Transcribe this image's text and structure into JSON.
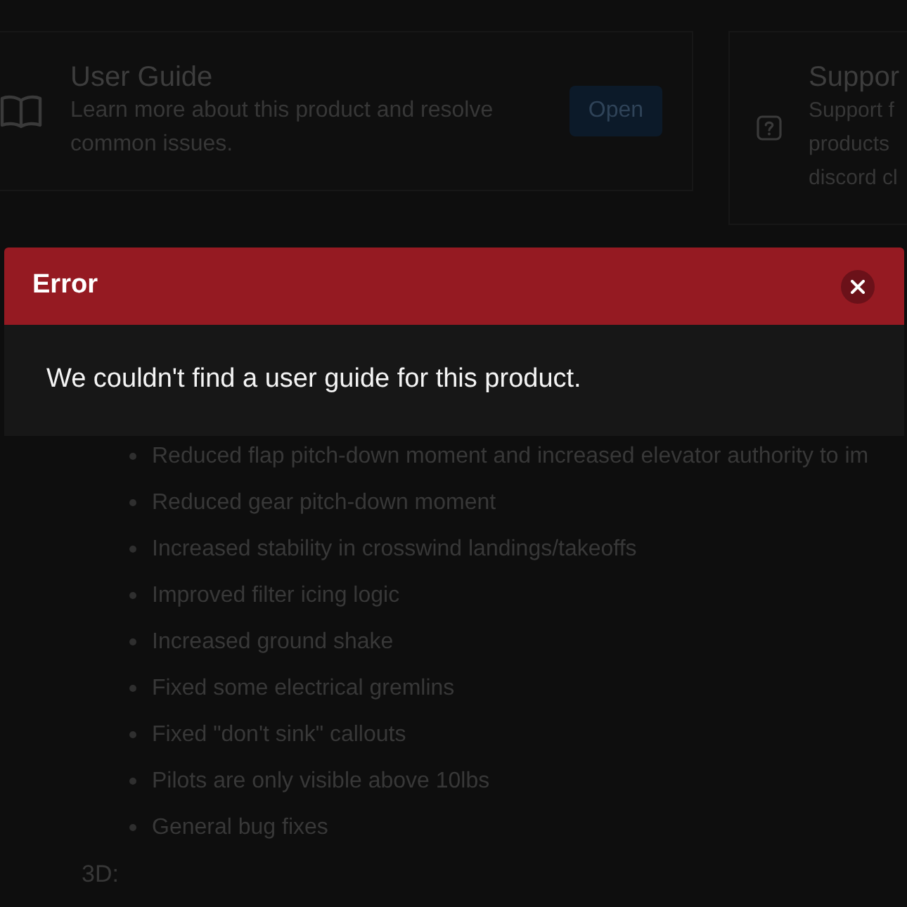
{
  "cards": [
    {
      "kind": "guide",
      "title": "User Guide",
      "description_lines": [
        "Learn more about this product and resolve common issues."
      ],
      "button": "Open"
    },
    {
      "kind": "support",
      "title": "Suppor",
      "description_lines": [
        "Support f",
        "products",
        "discord cl"
      ]
    }
  ],
  "dialog": {
    "title": "Error",
    "message": "We couldn't find a user guide for this product."
  },
  "changelog": {
    "items": [
      "Reduced flap pitch-down moment and increased elevator authority to im",
      "Reduced gear pitch-down moment",
      "Increased stability in crosswind landings/takeoffs",
      "Improved filter icing logic",
      "Increased ground shake",
      "Fixed some electrical gremlins",
      "Fixed \"don't sink\" callouts",
      "Pilots are only visible above 10lbs",
      "General bug fixes"
    ],
    "next_heading": "3D:"
  }
}
